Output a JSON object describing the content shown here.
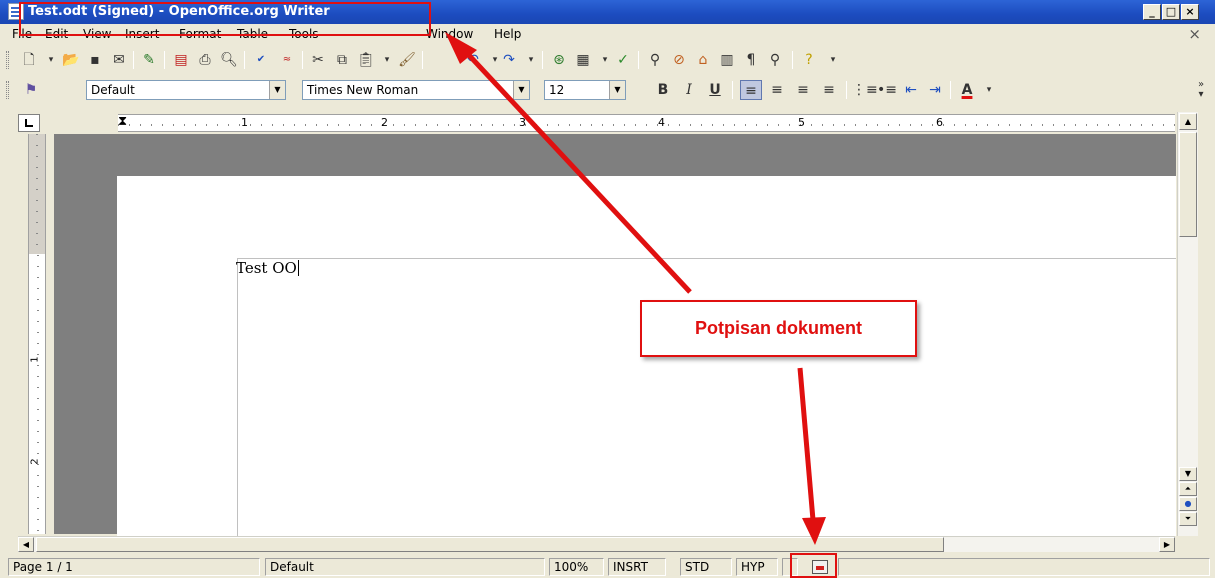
{
  "window": {
    "title": "Test.odt (Signed) - OpenOffice.org Writer",
    "minimize": "_",
    "maximize": "□",
    "close": "×"
  },
  "menu": {
    "items": [
      "File",
      "Edit",
      "View",
      "Insert",
      "Format",
      "Table",
      "Tools",
      "Window",
      "Help"
    ],
    "close_doc": "×"
  },
  "format_toolbar": {
    "style": "Default",
    "font": "Times New Roman",
    "size": "12",
    "bold": "B",
    "italic": "I",
    "underline": "U",
    "font_color": "A"
  },
  "ruler": {
    "numbers": [
      "1",
      "2",
      "3",
      "4",
      "5",
      "6"
    ],
    "vertical_numbers": [
      "1",
      "2"
    ]
  },
  "document": {
    "text": "Test OO"
  },
  "statusbar": {
    "page": "Page 1 / 1",
    "page_style": "Default",
    "zoom": "100%",
    "insert_mode": "INSRT",
    "selection_mode": "STD",
    "hyphenation": "HYP"
  },
  "annotation": {
    "callout": "Potpisan dokument",
    "color": "#e01010"
  }
}
